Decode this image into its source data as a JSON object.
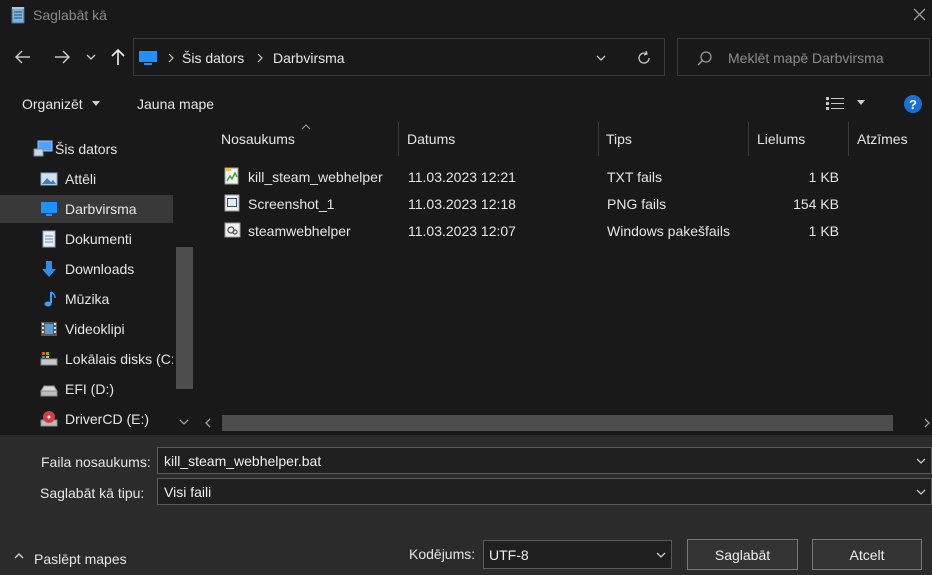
{
  "window": {
    "title": "Saglabāt kā"
  },
  "address": {
    "crumbs": [
      "Šis dators",
      "Darbvirsma"
    ]
  },
  "search": {
    "placeholder": "Meklēt mapē Darbvirsma"
  },
  "toolbar": {
    "organize": "Organizēt",
    "new_folder": "Jauna mape"
  },
  "sidebar": {
    "root": "Šis dators",
    "items": [
      {
        "label": "Attēli",
        "icon": "pictures-icon"
      },
      {
        "label": "Darbvirsma",
        "icon": "desktop-icon",
        "selected": true
      },
      {
        "label": "Dokumenti",
        "icon": "documents-icon"
      },
      {
        "label": "Downloads",
        "icon": "downloads-icon"
      },
      {
        "label": "Mūzika",
        "icon": "music-icon"
      },
      {
        "label": "Videoklipi",
        "icon": "videos-icon"
      },
      {
        "label": "Lokālais disks (C:",
        "icon": "local-disk-icon"
      },
      {
        "label": "EFI (D:)",
        "icon": "drive-icon"
      },
      {
        "label": "DriverCD (E:)",
        "icon": "cd-drive-icon"
      }
    ]
  },
  "columns": {
    "name": "Nosaukums",
    "date": "Datums",
    "type": "Tips",
    "size": "Lielums",
    "tags": "Atzīmes"
  },
  "files": [
    {
      "name": "kill_steam_webhelper",
      "date": "11.03.2023 12:21",
      "type": "TXT fails",
      "size": "1 KB",
      "icon": "txt-file-icon"
    },
    {
      "name": "Screenshot_1",
      "date": "11.03.2023 12:18",
      "type": "PNG fails",
      "size": "154 KB",
      "icon": "png-file-icon"
    },
    {
      "name": "steamwebhelper",
      "date": "11.03.2023 12:07",
      "type": "Windows pakešfails",
      "size": "1 KB",
      "icon": "bat-file-icon"
    }
  ],
  "form": {
    "filename_label": "Faila nosaukums:",
    "filename_value": "kill_steam_webhelper.bat",
    "type_label": "Saglabāt kā tipu:",
    "type_value": "Visi faili",
    "hide_folders": "Paslēpt mapes",
    "encoding_label": "Kodējums:",
    "encoding_value": "UTF-8",
    "save": "Saglabāt",
    "cancel": "Atcelt"
  },
  "colors": {
    "accent": "#1e90ff",
    "help": "#1a6fd6"
  }
}
